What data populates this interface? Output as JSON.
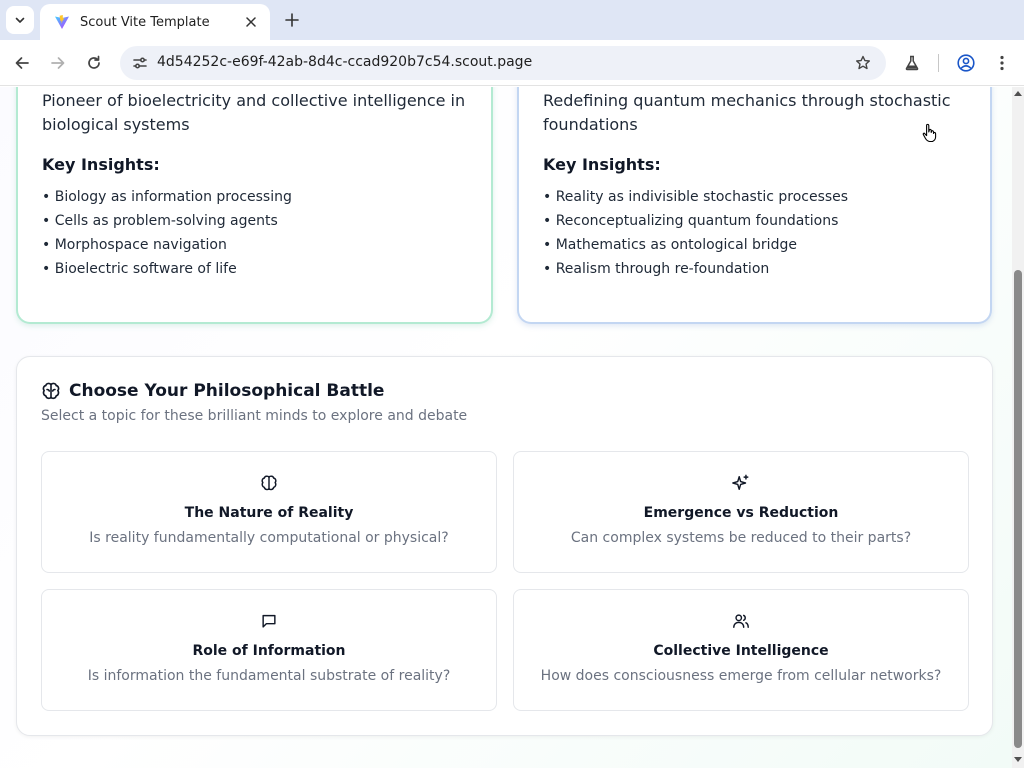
{
  "browser": {
    "tab_title": "Scout Vite Template",
    "url": "4d54252c-e69f-42ab-8d4c-ccad920b7c54.scout.page",
    "icons": [
      "tab-list-icon",
      "vite-favicon",
      "close-icon",
      "plus-icon",
      "back-icon",
      "forward-icon",
      "reload-icon",
      "tune-icon",
      "star-icon",
      "labs-icon",
      "profile-icon",
      "menu-icon"
    ]
  },
  "profiles": [
    {
      "description": "Pioneer of bioelectricity and collective intelligence in biological systems",
      "insights_title": "Key Insights:",
      "insights": [
        "• Biology as information processing",
        "• Cells as problem-solving agents",
        "• Morphospace navigation",
        "• Bioelectric software of life"
      ],
      "accent": "#b3ead2"
    },
    {
      "description": "Redefining quantum mechanics through stochastic foundations",
      "insights_title": "Key Insights:",
      "insights": [
        "• Reality as indivisible stochastic processes",
        "• Reconceptualizing quantum foundations",
        "• Mathematics as ontological bridge",
        "• Realism through re-foundation"
      ],
      "accent": "#c3d6f2"
    }
  ],
  "battle": {
    "title": "Choose Your Philosophical Battle",
    "subtitle": "Select a topic for these brilliant minds to explore and debate",
    "icon": "brain-icon",
    "topics": [
      {
        "icon": "brain-icon",
        "title": "The Nature of Reality",
        "description": "Is reality fundamentally computational or physical?"
      },
      {
        "icon": "sparkles-icon",
        "title": "Emergence vs Reduction",
        "description": "Can complex systems be reduced to their parts?"
      },
      {
        "icon": "message-square-icon",
        "title": "Role of Information",
        "description": "Is information the fundamental substrate of reality?"
      },
      {
        "icon": "users-icon",
        "title": "Collective Intelligence",
        "description": "How does consciousness emerge from cellular networks?"
      }
    ]
  }
}
